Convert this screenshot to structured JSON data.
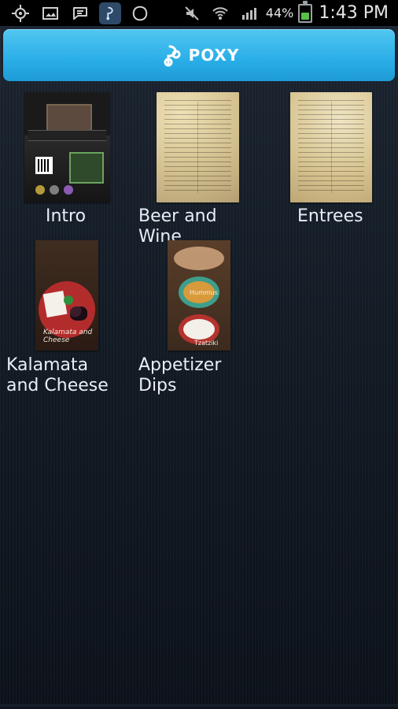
{
  "status_bar": {
    "battery_percent": "44%",
    "time": "1:43 PM",
    "icons_left": [
      "gps-icon",
      "gallery-icon",
      "messaging-icon",
      "poxy-app-icon",
      "blob-app-icon"
    ],
    "icons_right": [
      "mute-icon",
      "wifi-icon",
      "signal-icon",
      "battery-icon"
    ]
  },
  "header": {
    "logo_text": "POXY",
    "brand_color": "#2aaee8"
  },
  "grid": {
    "items": [
      {
        "label": "Intro"
      },
      {
        "label": "Beer and Wine"
      },
      {
        "label": "Entrees"
      },
      {
        "label": "Kalamata and Cheese"
      },
      {
        "label": "Appetizer Dips"
      }
    ]
  },
  "thumb_text": {
    "kalamata_caption": "Kalamata and Cheese",
    "dip_label_1": "Hummus",
    "dip_label_2": "Tzatziki"
  }
}
